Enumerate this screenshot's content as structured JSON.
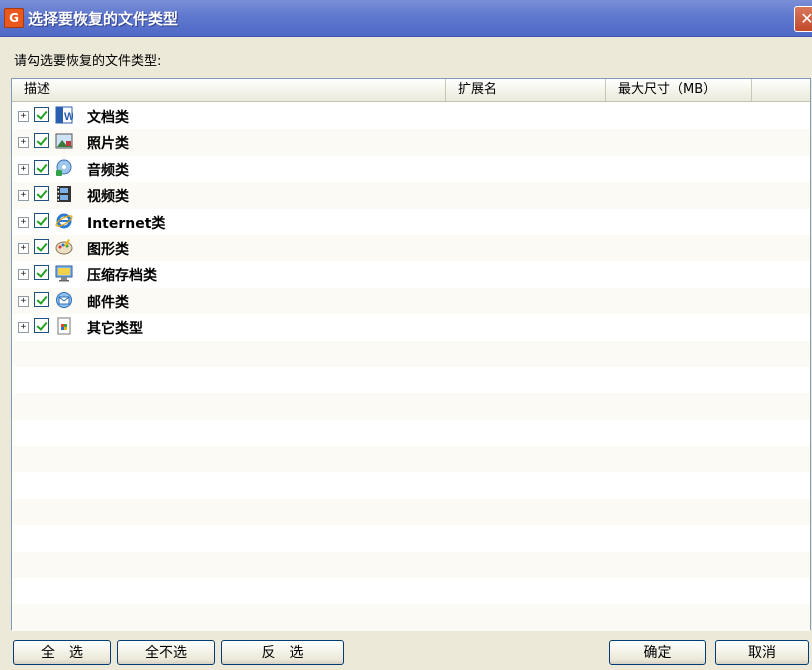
{
  "window": {
    "title": "选择要恢复的文件类型",
    "app_icon_text": "G"
  },
  "prompt": "请勾选要恢复的文件类型:",
  "columns": {
    "description": "描述",
    "extension": "扩展名",
    "max_size": "最大尺寸（MB）"
  },
  "items": [
    {
      "label": "文档类",
      "icon": "word-document-icon",
      "checked": true
    },
    {
      "label": "照片类",
      "icon": "photo-icon",
      "checked": true
    },
    {
      "label": "音频类",
      "icon": "audio-icon",
      "checked": true
    },
    {
      "label": "视频类",
      "icon": "video-film-icon",
      "checked": true
    },
    {
      "label": "Internet类",
      "icon": "internet-explorer-icon",
      "checked": true
    },
    {
      "label": "图形类",
      "icon": "palette-icon",
      "checked": true
    },
    {
      "label": "压缩存档类",
      "icon": "archive-icon",
      "checked": true
    },
    {
      "label": "邮件类",
      "icon": "mail-icon",
      "checked": true
    },
    {
      "label": "其它类型",
      "icon": "other-files-icon",
      "checked": true
    }
  ],
  "buttons": {
    "select_all": "全　选",
    "select_none": "全不选",
    "invert": "反　选",
    "ok": "确定",
    "cancel": "取消"
  }
}
